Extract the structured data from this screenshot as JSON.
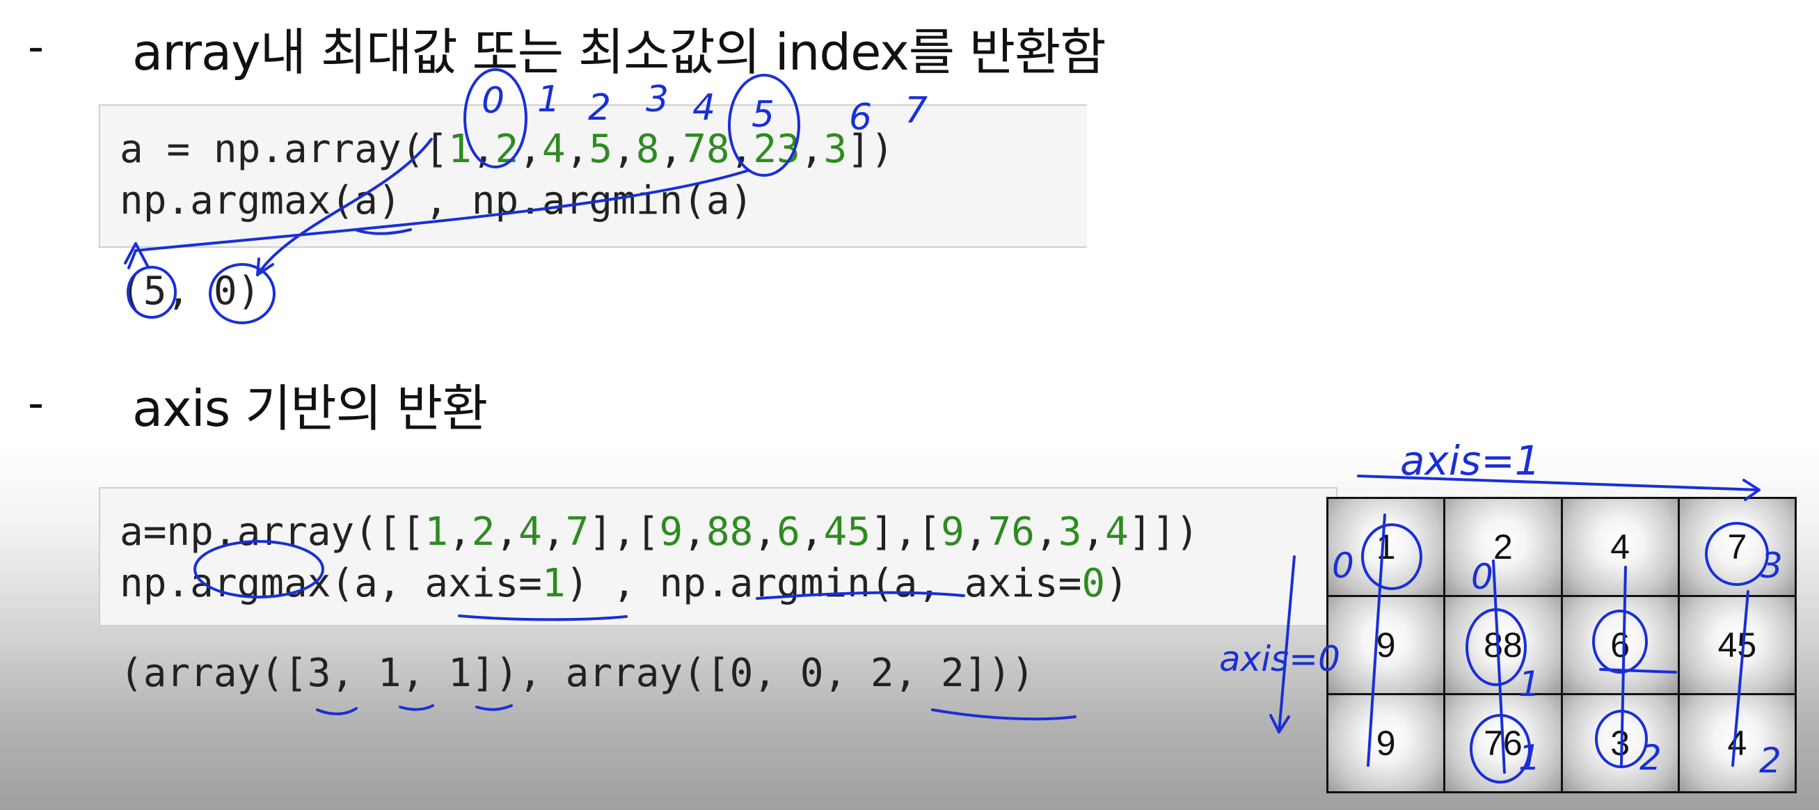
{
  "section1": {
    "bullet": "-",
    "heading": "array내 최대값 또는 최소값의 index를 반환함",
    "code_line1_parts": [
      "a = np.array([",
      "1",
      ",",
      "2",
      ",",
      "4",
      ",",
      "5",
      ",",
      "8",
      ",",
      "78",
      ",",
      "23",
      ",",
      "3",
      "])"
    ],
    "code_line2": "np.argmax(a) , np.argmin(a)",
    "output": "(5, 0)"
  },
  "section2": {
    "bullet": "-",
    "heading": "axis 기반의 반환",
    "code_line1_parts": [
      "a=np.array([[",
      "1",
      ",",
      "2",
      ",",
      "4",
      ",",
      "7",
      "],[",
      "9",
      ",",
      "88",
      ",",
      "6",
      ",",
      "45",
      "],[",
      "9",
      ",",
      "76",
      ",",
      "3",
      ",",
      "4",
      "]])"
    ],
    "code_line2_parts": [
      "np.argmax(a, axis=",
      "1",
      ") , np.argmin(a, axis=",
      "0",
      ")"
    ],
    "output": "(array([3, 1, 1]), array([0, 0, 2, 2]))"
  },
  "matrix": {
    "rows": [
      [
        "1",
        "2",
        "4",
        "7"
      ],
      [
        "9",
        "88",
        "6",
        "45"
      ],
      [
        "9",
        "76",
        "3",
        "4"
      ]
    ]
  },
  "annotations": {
    "index_labels": [
      "0",
      "1",
      "2",
      "3",
      "4",
      "5",
      "6",
      "7"
    ],
    "axis1_label": "axis=1",
    "axis0_label": "axis=0",
    "row_argmax_marks": [
      "0",
      "1",
      "2"
    ],
    "col_argmin_marks": [
      "0",
      "0",
      "2",
      "2"
    ],
    "row_max_col_marks": [
      "3",
      "1",
      "1"
    ],
    "ink_color": "#1a2fd6"
  },
  "colors": {
    "number_green": "#2e8b20",
    "code_bg": "#f5f5f5",
    "ink_blue": "#1a2fd6"
  }
}
